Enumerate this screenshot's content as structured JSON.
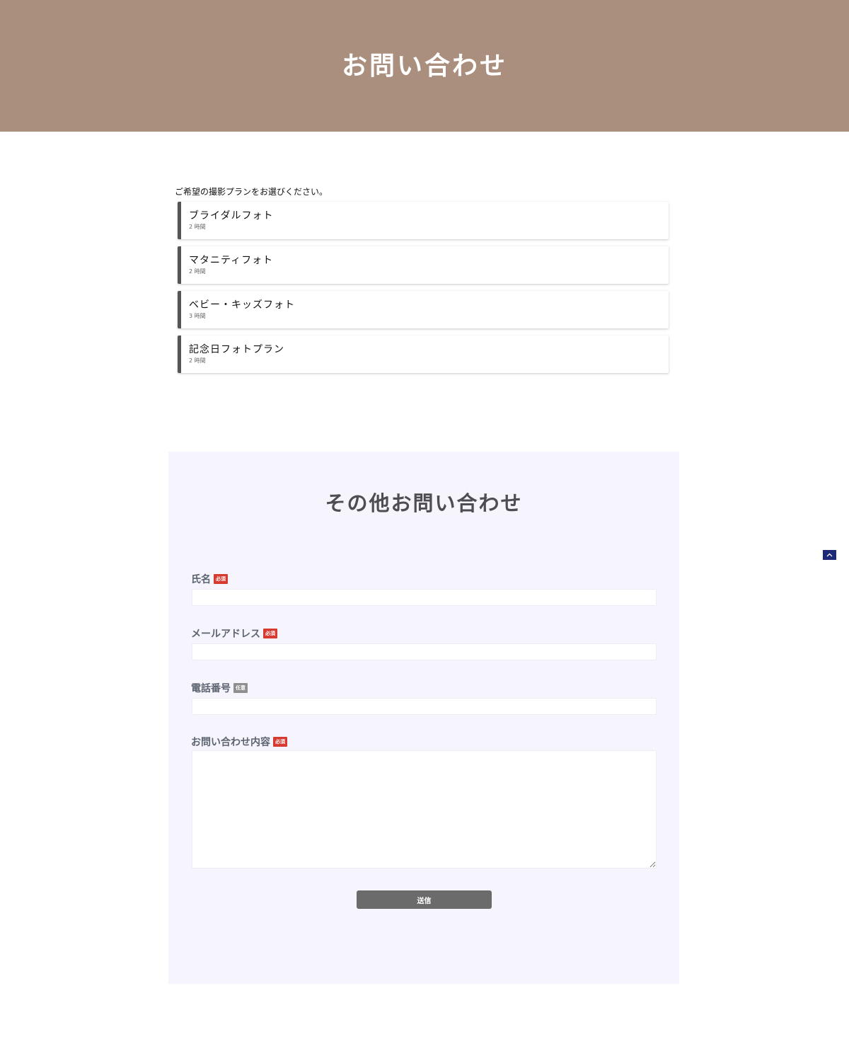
{
  "header": {
    "title": "お問い合わせ"
  },
  "plans": {
    "prompt": "ご希望の撮影プランをお選びください。",
    "items": [
      {
        "name": "ブライダルフォト",
        "duration": "2 時間"
      },
      {
        "name": "マタニティフォト",
        "duration": "2 時間"
      },
      {
        "name": "ベビー・キッズフォト",
        "duration": "3 時間"
      },
      {
        "name": "記念日フォトプラン",
        "duration": "2 時間"
      }
    ]
  },
  "contact": {
    "title": "その他お問い合わせ",
    "fields": {
      "name": {
        "label": "氏名",
        "badge": "必須",
        "value": ""
      },
      "email": {
        "label": "メールアドレス",
        "badge": "必須",
        "value": ""
      },
      "phone": {
        "label": "電話番号",
        "badge": "任意",
        "value": ""
      },
      "message": {
        "label": "お問い合わせ内容",
        "badge": "必須",
        "value": ""
      }
    },
    "submit_label": "送信"
  },
  "colors": {
    "hero_background": "#aa8f7e",
    "panel_background": "#f6f4fc",
    "required_badge": "#d63a30",
    "optional_badge": "#8f8f8f",
    "submit_button": "#6b6b6b",
    "back_to_top": "#1e2a78"
  },
  "icons": {
    "back_to_top": "chevron-up-icon"
  }
}
